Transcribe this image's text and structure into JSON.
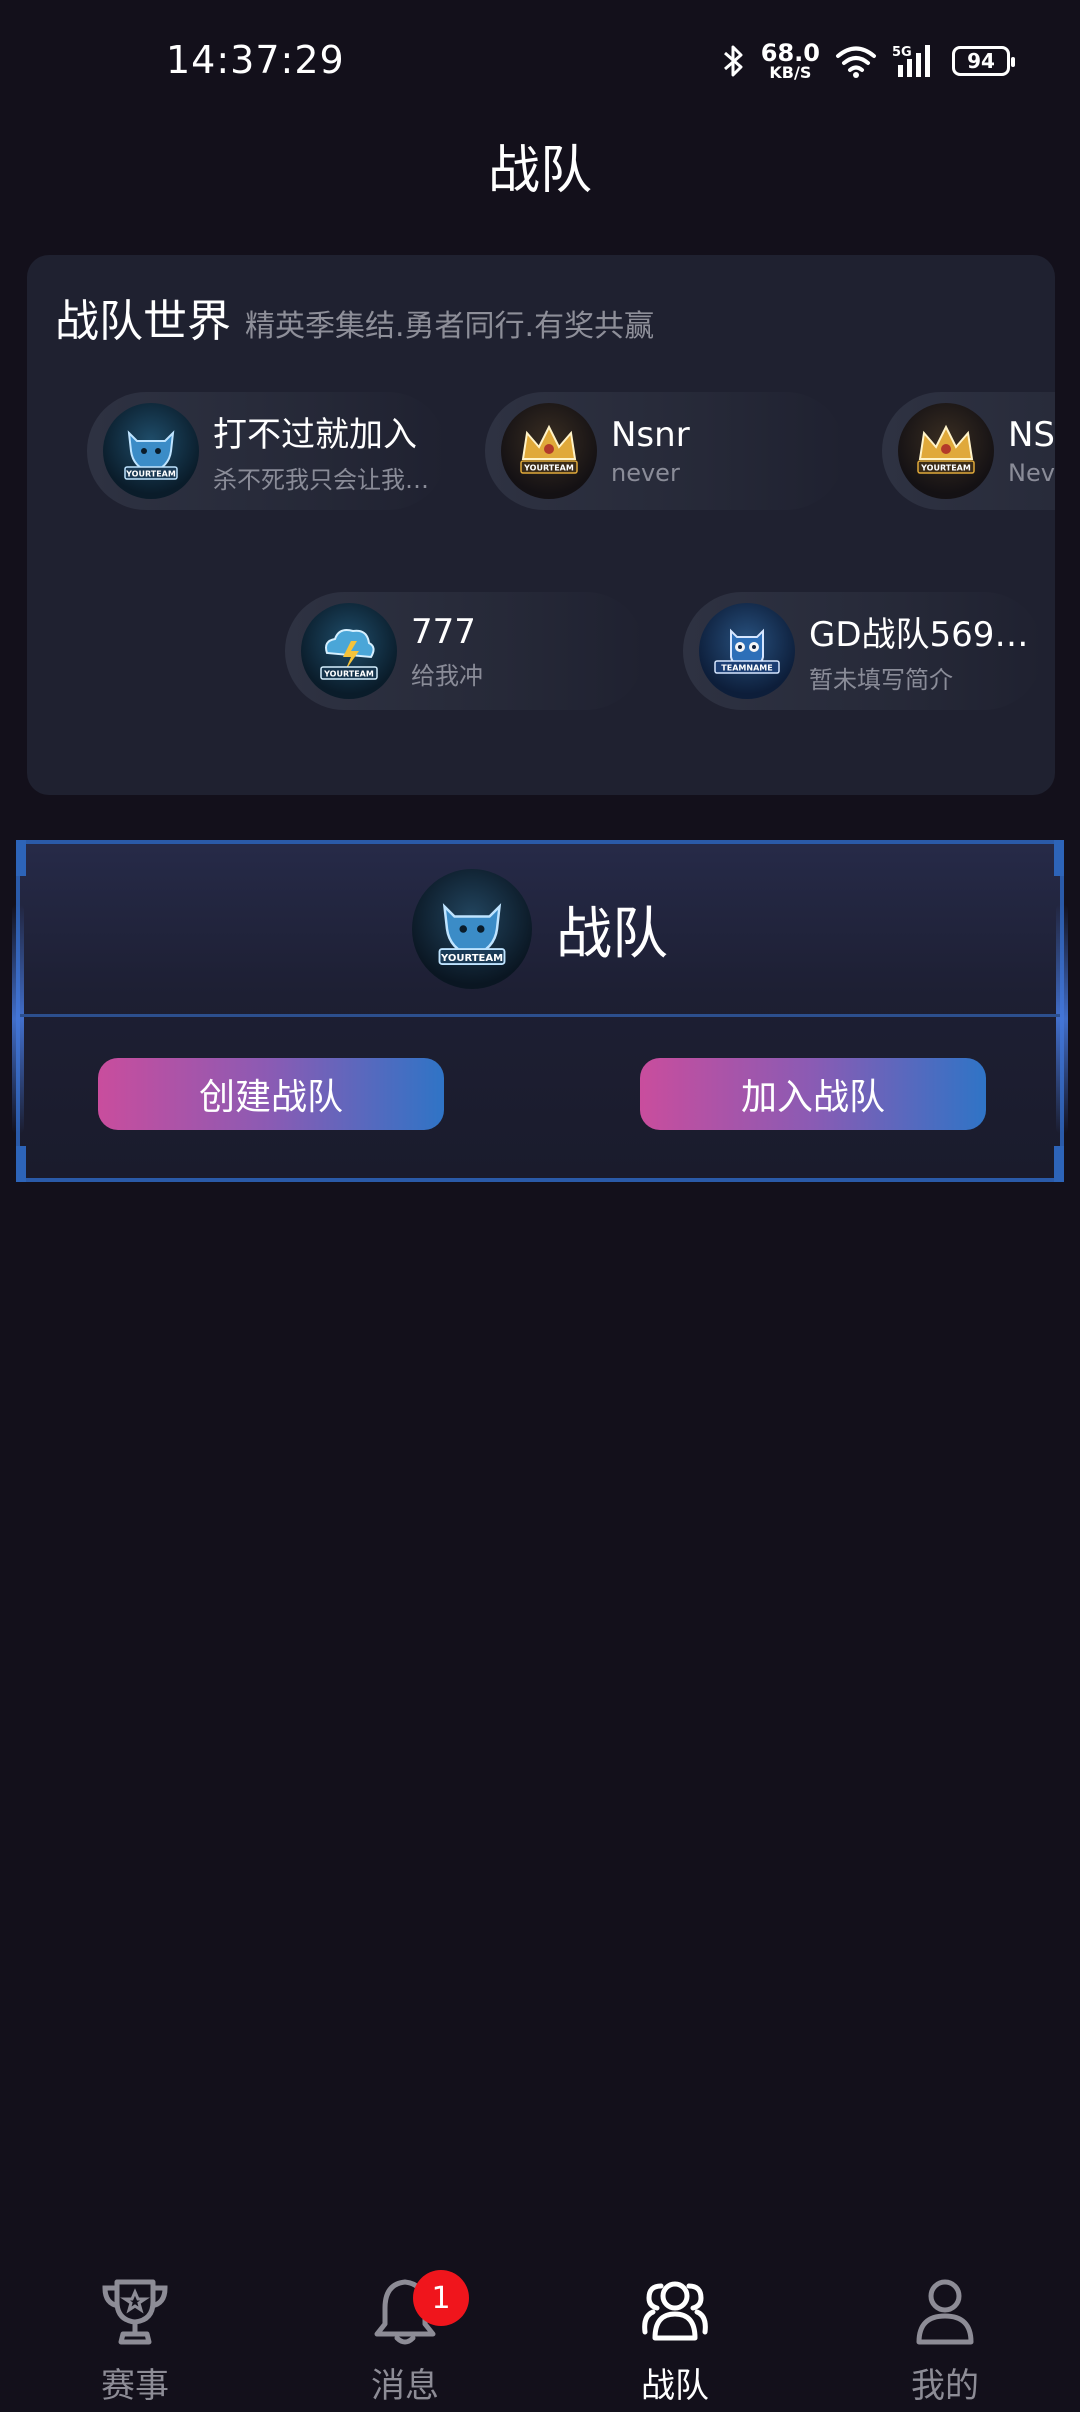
{
  "status_bar": {
    "time": "14:37:29",
    "net_speed_value": "68.0",
    "net_speed_unit": "KB/S",
    "network_type": "5G",
    "battery": "94"
  },
  "page_title": "战队",
  "world": {
    "title": "战队世界",
    "subtitle": "精英季集结.勇者同行.有奖共赢",
    "teams": [
      {
        "name": "打不过就加入",
        "desc": "杀不死我只会让我…",
        "icon": "yourteam-ox-badge"
      },
      {
        "name": "Nsnr",
        "desc": "never",
        "icon": "yourteam-crown-badge"
      },
      {
        "name": "NSI",
        "desc": "Neve",
        "icon": "yourteam-crown-badge"
      },
      {
        "name": "777",
        "desc": "给我冲",
        "icon": "yourteam-storm-badge"
      },
      {
        "name": "GD战队5697…",
        "desc": "暂未填写简介",
        "icon": "teamname-owl-badge"
      }
    ]
  },
  "team_panel": {
    "title": "战队",
    "create_label": "创建战队",
    "join_label": "加入战队"
  },
  "nav": {
    "items": [
      {
        "label": "赛事",
        "icon": "trophy-icon"
      },
      {
        "label": "消息",
        "icon": "bell-icon",
        "badge": "1"
      },
      {
        "label": "战队",
        "icon": "team-icon",
        "active": true
      },
      {
        "label": "我的",
        "icon": "user-icon"
      }
    ]
  },
  "colors": {
    "background": "#13101b",
    "card": "#1f2130",
    "accent_pink": "#c94d9d",
    "accent_blue": "#2f74c6",
    "badge_red": "#f0151c"
  }
}
